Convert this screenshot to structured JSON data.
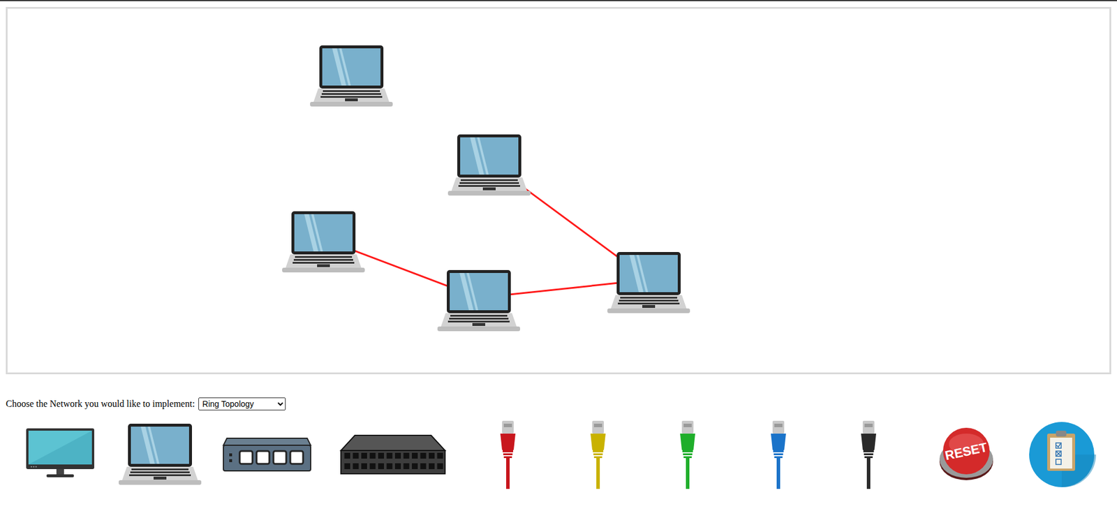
{
  "canvas": {
    "devices": [
      {
        "kind": "laptop"
      },
      {
        "kind": "laptop"
      },
      {
        "kind": "laptop"
      },
      {
        "kind": "laptop"
      },
      {
        "kind": "laptop"
      }
    ],
    "links": [
      {
        "from": 1,
        "to": 4,
        "color": "#ff1a1a"
      },
      {
        "from": 2,
        "to": 3,
        "color": "#ff1a1a"
      },
      {
        "from": 3,
        "to": 4,
        "color": "#ff1a1a"
      }
    ]
  },
  "topology": {
    "label": "Choose the Network you would like to implement:",
    "value": "Ring Topology"
  },
  "palette": [
    {
      "kind": "monitor"
    },
    {
      "kind": "laptop"
    },
    {
      "kind": "switch"
    },
    {
      "kind": "large-switch"
    },
    {
      "kind": "cable",
      "color": "#c8161d"
    },
    {
      "kind": "cable",
      "color": "#c9b200"
    },
    {
      "kind": "cable",
      "color": "#1fae2b"
    },
    {
      "kind": "cable",
      "color": "#1a73c9"
    },
    {
      "kind": "cable",
      "color": "#2a2a2a"
    },
    {
      "kind": "reset",
      "label": "RESET"
    },
    {
      "kind": "checklist"
    }
  ]
}
